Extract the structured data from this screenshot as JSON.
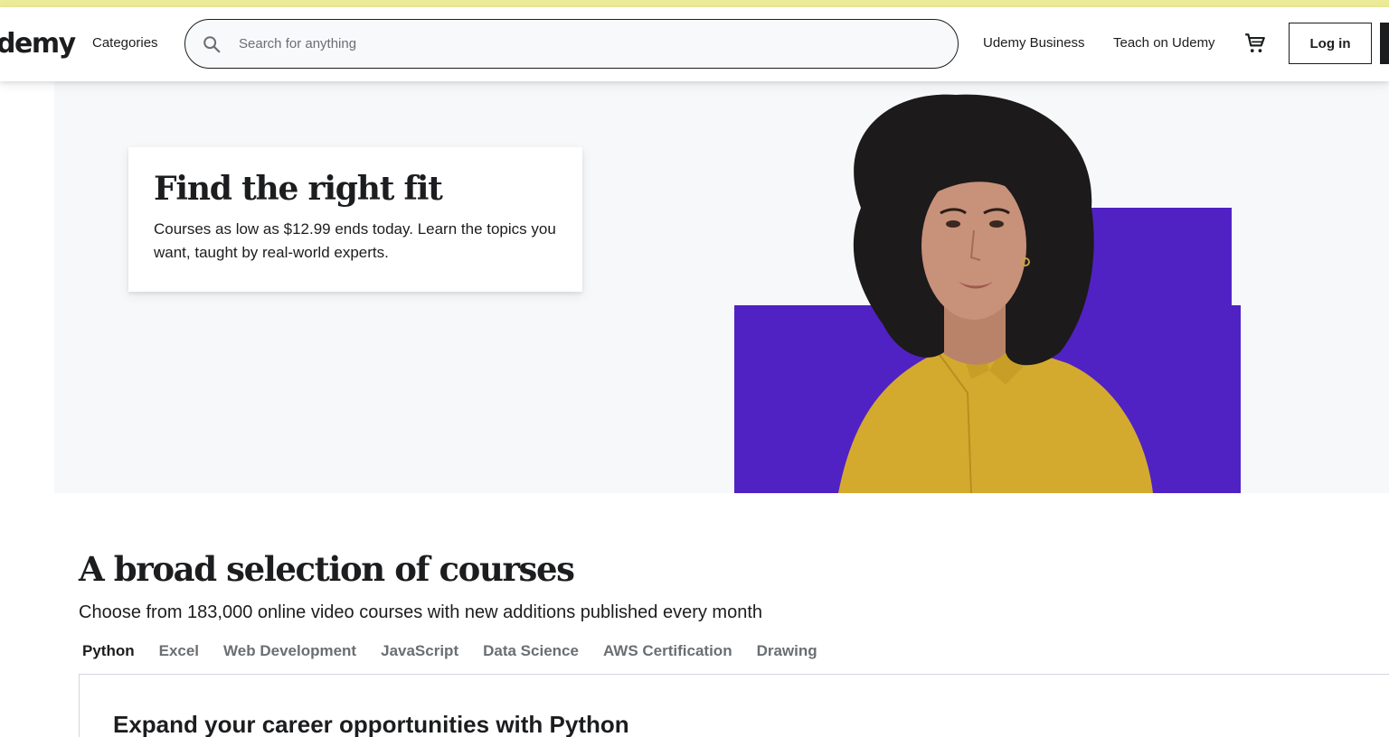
{
  "header": {
    "logo": "demy",
    "categories_label": "Categories",
    "search_placeholder": "Search for anything",
    "search_value": "",
    "business_link": "Udemy Business",
    "teach_link": "Teach on Udemy",
    "login_label": "Log in"
  },
  "hero": {
    "title": "Find the right fit",
    "text": "Courses as low as $12.99 ends today. Learn the topics you want, taught by real-world experts.",
    "accent_color": "#5022c3",
    "shirt_color": "#d4aa2e"
  },
  "courses": {
    "title": "A broad selection of courses",
    "subtitle": "Choose from 183,000 online video courses with new additions published every month",
    "tabs": [
      {
        "label": "Python",
        "active": true
      },
      {
        "label": "Excel",
        "active": false
      },
      {
        "label": "Web Development",
        "active": false
      },
      {
        "label": "JavaScript",
        "active": false
      },
      {
        "label": "Data Science",
        "active": false
      },
      {
        "label": "AWS Certification",
        "active": false
      },
      {
        "label": "Drawing",
        "active": false
      }
    ],
    "panel_title": "Expand your career opportunities with Python"
  },
  "colors": {
    "top_strip": "#eceb98",
    "text": "#1c1d1f",
    "muted": "#6a6f73"
  }
}
